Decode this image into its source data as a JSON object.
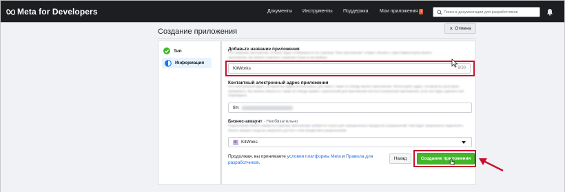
{
  "topbar": {
    "brand": "Meta for Developers",
    "nav": [
      "Документы",
      "Инструменты",
      "Поддержка",
      "Мои приложения"
    ],
    "apps_badge": "2",
    "search_placeholder": "Поиск в документации для разработчиков"
  },
  "page": {
    "title": "Создание приложения",
    "cancel_label": "Отмена"
  },
  "steps": [
    {
      "label": "Тип",
      "state": "done"
    },
    {
      "label": "Информация",
      "state": "active"
    }
  ],
  "app_name": {
    "label": "Добавьте название приложения",
    "desc_line1": "Это название приложения, которое будет отображаться на странице \"Мои приложения\" и будет связано с идентификатором вашего",
    "desc_line2": "приложения. Вы можете изменить название позже в настройках.",
    "value": "KitWorks",
    "counter": "8/30"
  },
  "contact_email": {
    "label": "Контактный электронный адрес приложения",
    "desc": "Это электронный адрес, который мы будем использовать для связи с вами по поводу вашего приложения. Используйте адрес, который вы регулярно проверяете. Мы можем связаться с вами по поводу правил, ограничений для приложения или восстановления приложения, если оно будет удалено или повреждено.",
    "value": "tim"
  },
  "business": {
    "label": "Бизнес-аккаунт",
    "optional": " · Необязательно",
    "desc": "Подключение бизнес-аккаунта к вашему приложению требуется только для определенных продуктов и разрешений. Нам будет предложено подключить бизнес-аккаунт, когда вы запросите доступ к этим продуктам и разрешениям.",
    "badge": "K",
    "selected": "KitWoks"
  },
  "footer": {
    "agree_prefix": "Продолжая, вы принимаете ",
    "link1": "условия платформы Meta",
    "and": " и ",
    "link2": "Правила для разработчиков",
    "suffix": ".",
    "back_label": "Назад",
    "create_label": "Создание приложения"
  },
  "colors": {
    "topbar": "#1c1e21",
    "accent_green": "#42b72a",
    "highlight_red": "#c8102e",
    "link_blue": "#216fdb",
    "step_active_bg": "#e7f3ff"
  }
}
